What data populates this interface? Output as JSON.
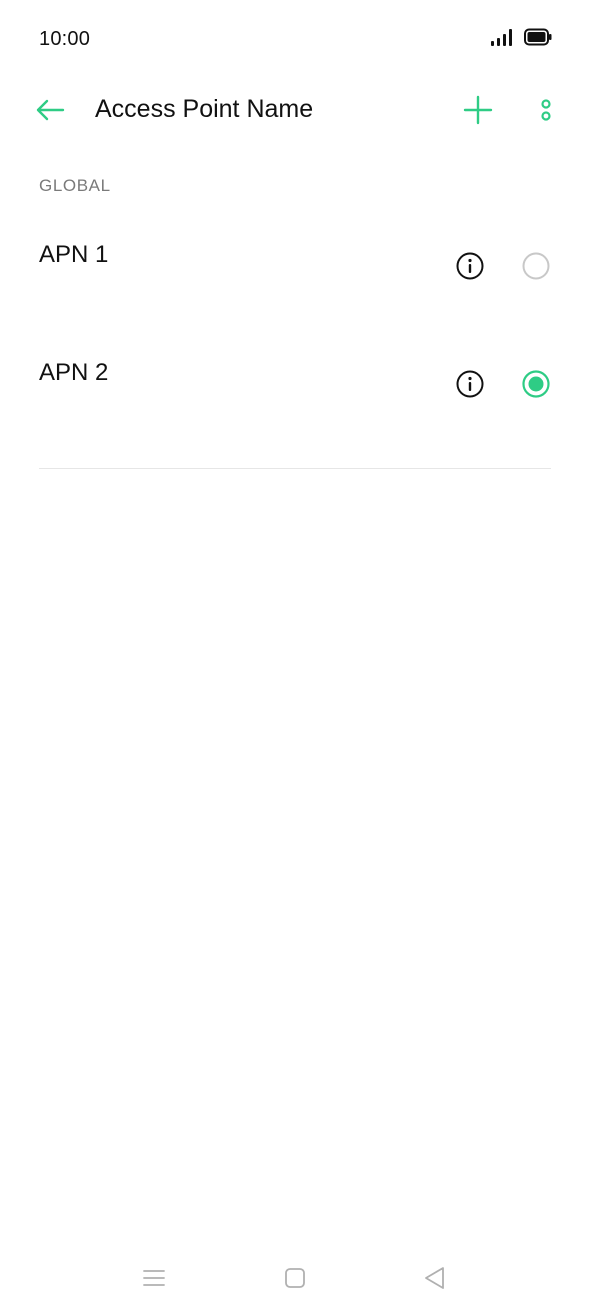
{
  "status_bar": {
    "time": "10:00",
    "icons": [
      "signal-icon",
      "battery-icon"
    ]
  },
  "toolbar": {
    "title": "Access Point Name",
    "back_icon": "arrow-left-icon",
    "add_icon": "plus-icon",
    "more_icon": "more-vertical-icon"
  },
  "section": {
    "header": "GLOBAL"
  },
  "apn_list": [
    {
      "label": "APN 1",
      "selected": false
    },
    {
      "label": "APN 2",
      "selected": true
    }
  ],
  "colors": {
    "accent": "#2ecc85",
    "text_primary": "#111111",
    "text_secondary": "#7a7a7a",
    "divider": "#e6e6e6",
    "radio_unselected": "#c8c8c8",
    "nav_icon": "#b0b0b0"
  },
  "nav_bar": {
    "icons": [
      "menu-icon",
      "home-icon",
      "back-triangle-icon"
    ]
  }
}
